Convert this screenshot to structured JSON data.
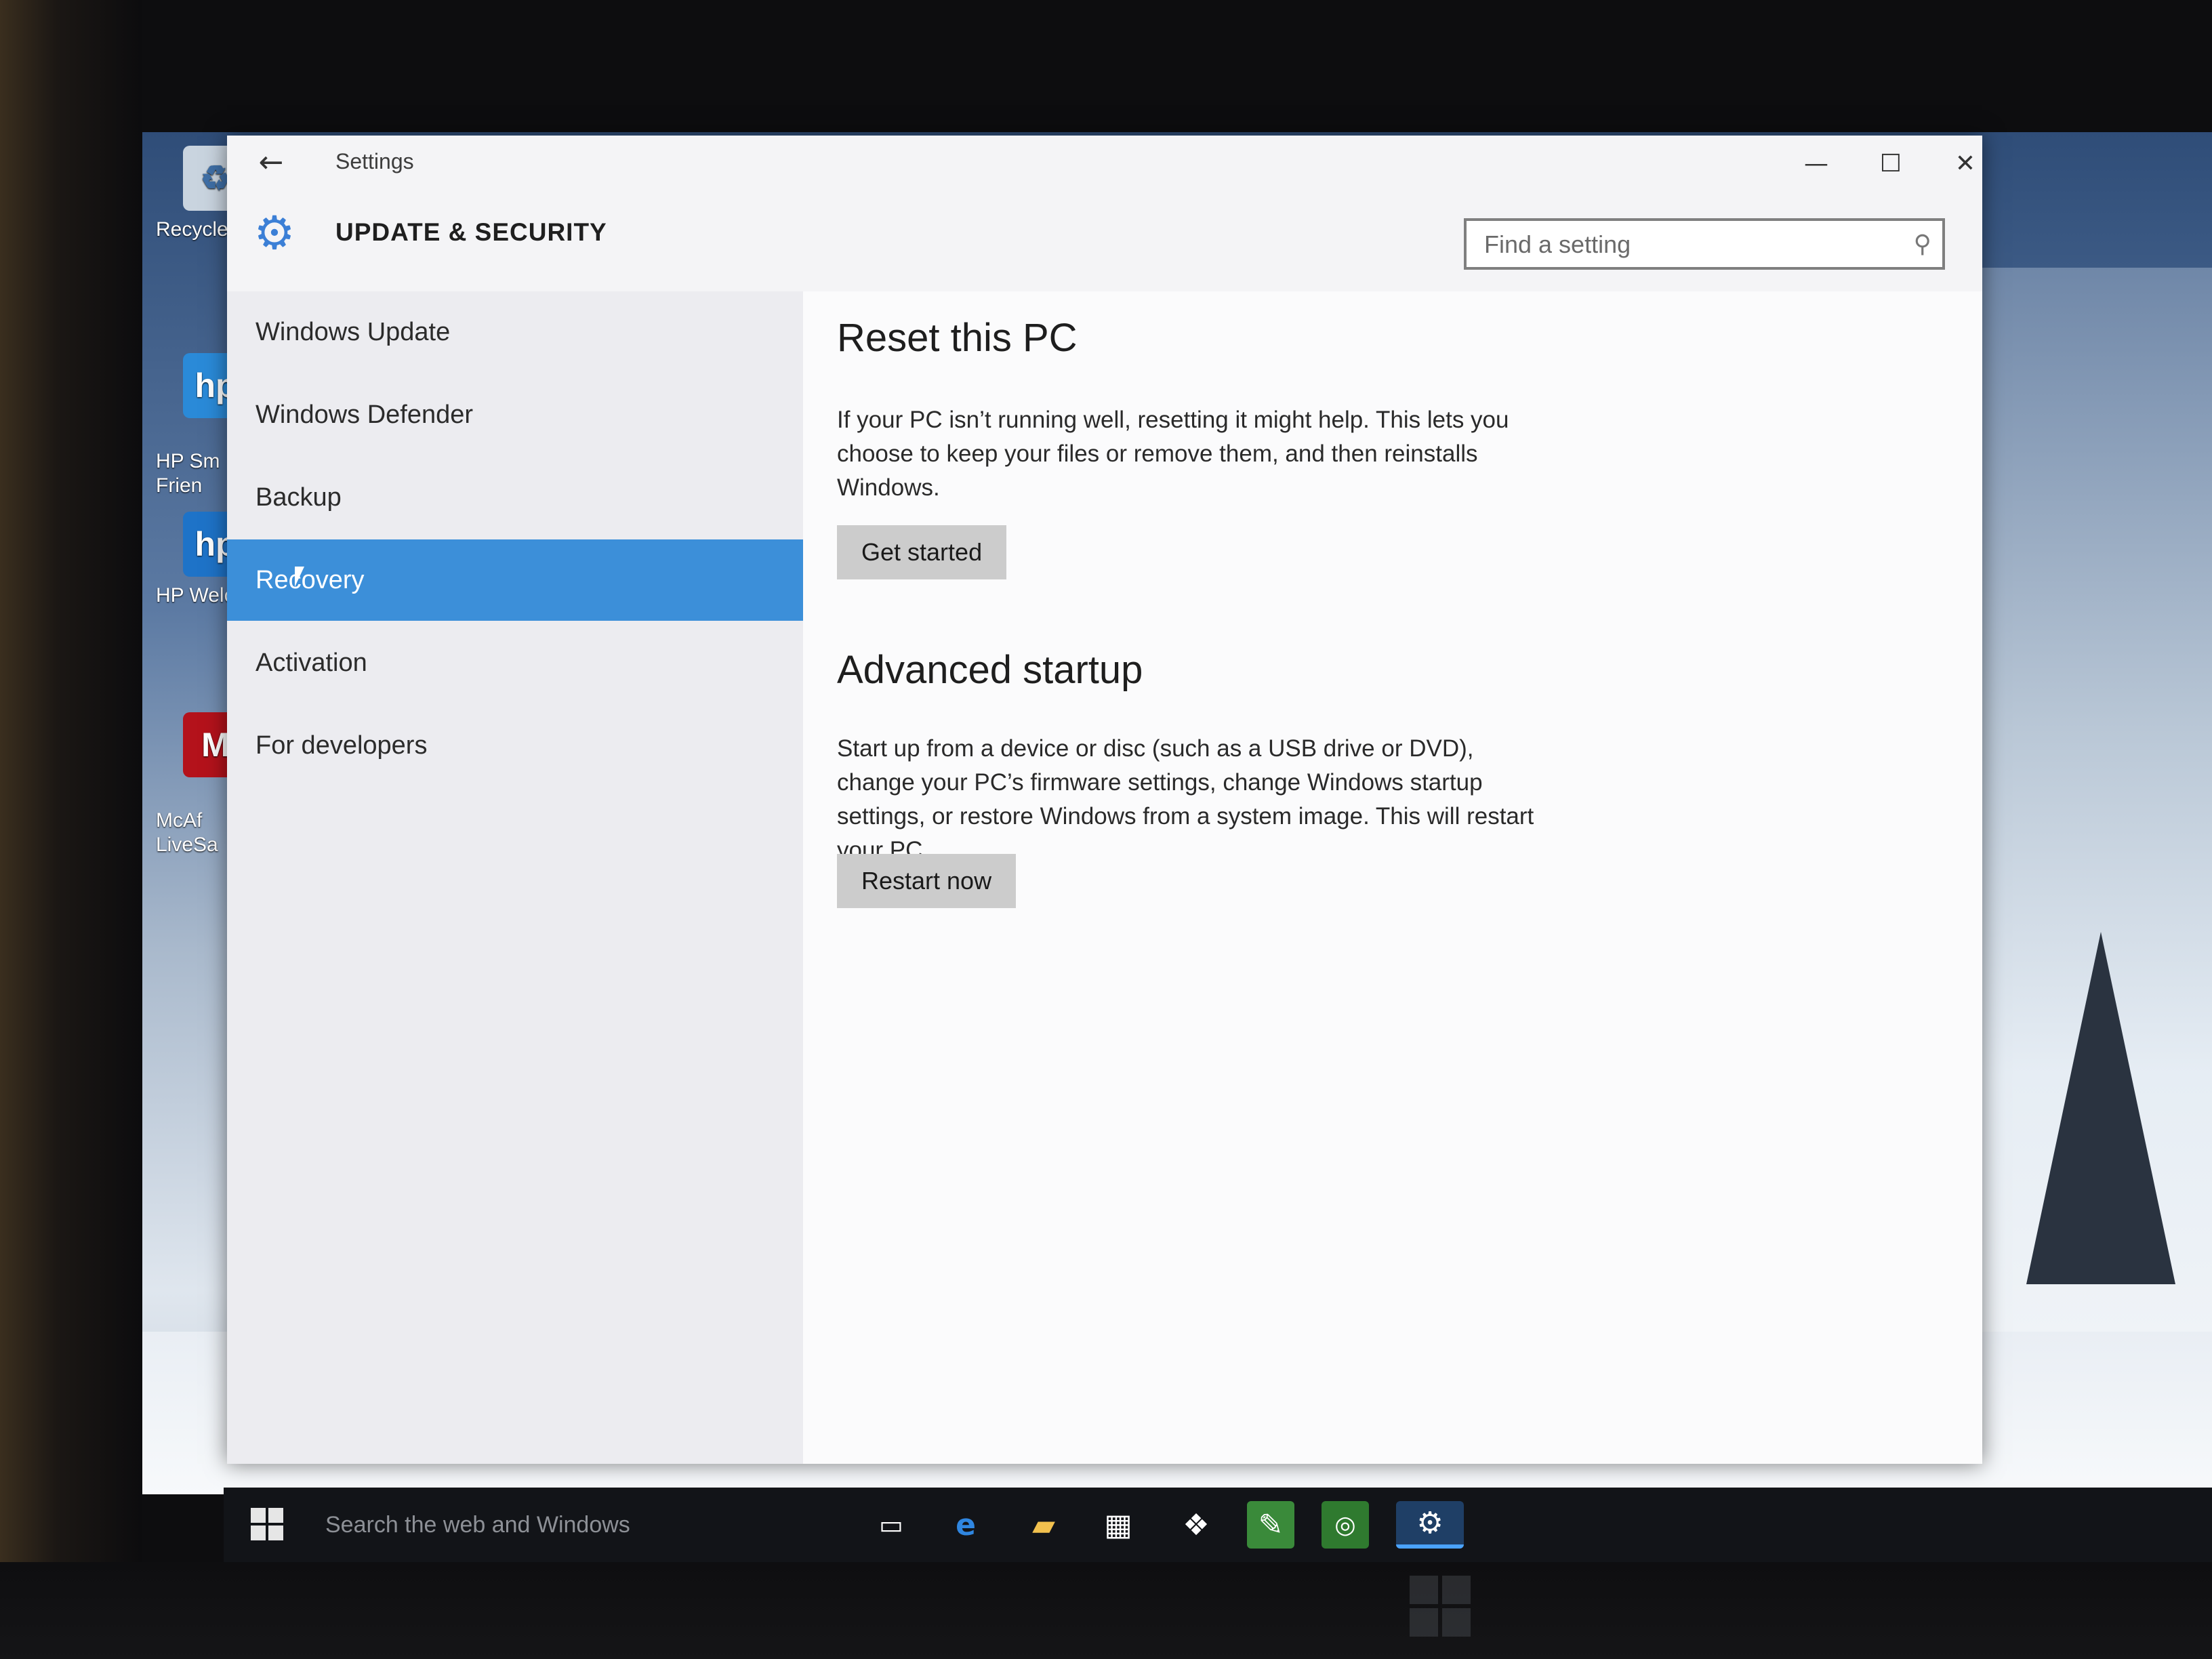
{
  "desktop": {
    "icons": [
      {
        "label": "Recycle",
        "icon": "recycle-bin-icon"
      },
      {
        "label": "HP Sm\nFrien",
        "icon": "hp-smart-friend-icon"
      },
      {
        "label": "HP Welc",
        "icon": "hp-welcome-icon"
      },
      {
        "label": "McAf\nLiveSa",
        "icon": "mcafee-livesafe-icon"
      }
    ]
  },
  "window": {
    "title": "Settings",
    "back_icon": "back-arrow-icon",
    "controls": {
      "minimize": "—",
      "maximize": "☐",
      "close": "✕"
    }
  },
  "header": {
    "title": "UPDATE & SECURITY",
    "icon": "gear-icon",
    "search_placeholder": "Find a setting"
  },
  "nav": {
    "items": [
      {
        "label": "Windows Update"
      },
      {
        "label": "Windows Defender"
      },
      {
        "label": "Backup"
      },
      {
        "label": "Recovery",
        "selected": true
      },
      {
        "label": "Activation"
      },
      {
        "label": "For developers"
      }
    ]
  },
  "content": {
    "reset": {
      "title": "Reset this PC",
      "body": "If your PC isn’t running well, resetting it might help. This lets you choose to keep your files or remove them, and then reinstalls Windows.",
      "button": "Get started"
    },
    "advanced": {
      "title": "Advanced startup",
      "body": "Start up from a device or disc (such as a USB drive or DVD), change your PC’s firmware settings, change Windows startup settings, or restore Windows from a system image. This will restart your PC.",
      "button": "Restart now"
    }
  },
  "taskbar": {
    "search_text": "Search the web and Windows",
    "items": [
      "task-view-icon",
      "edge-icon",
      "file-explorer-icon",
      "store-icon",
      "dropbox-icon",
      "evernote-icon",
      "tripadvisor-icon",
      "settings-icon"
    ]
  },
  "colors": {
    "accent": "#3c8fd9",
    "nav_bg": "#ececf0",
    "content_bg": "#fbfbfc",
    "button_bg": "#cccccc"
  }
}
